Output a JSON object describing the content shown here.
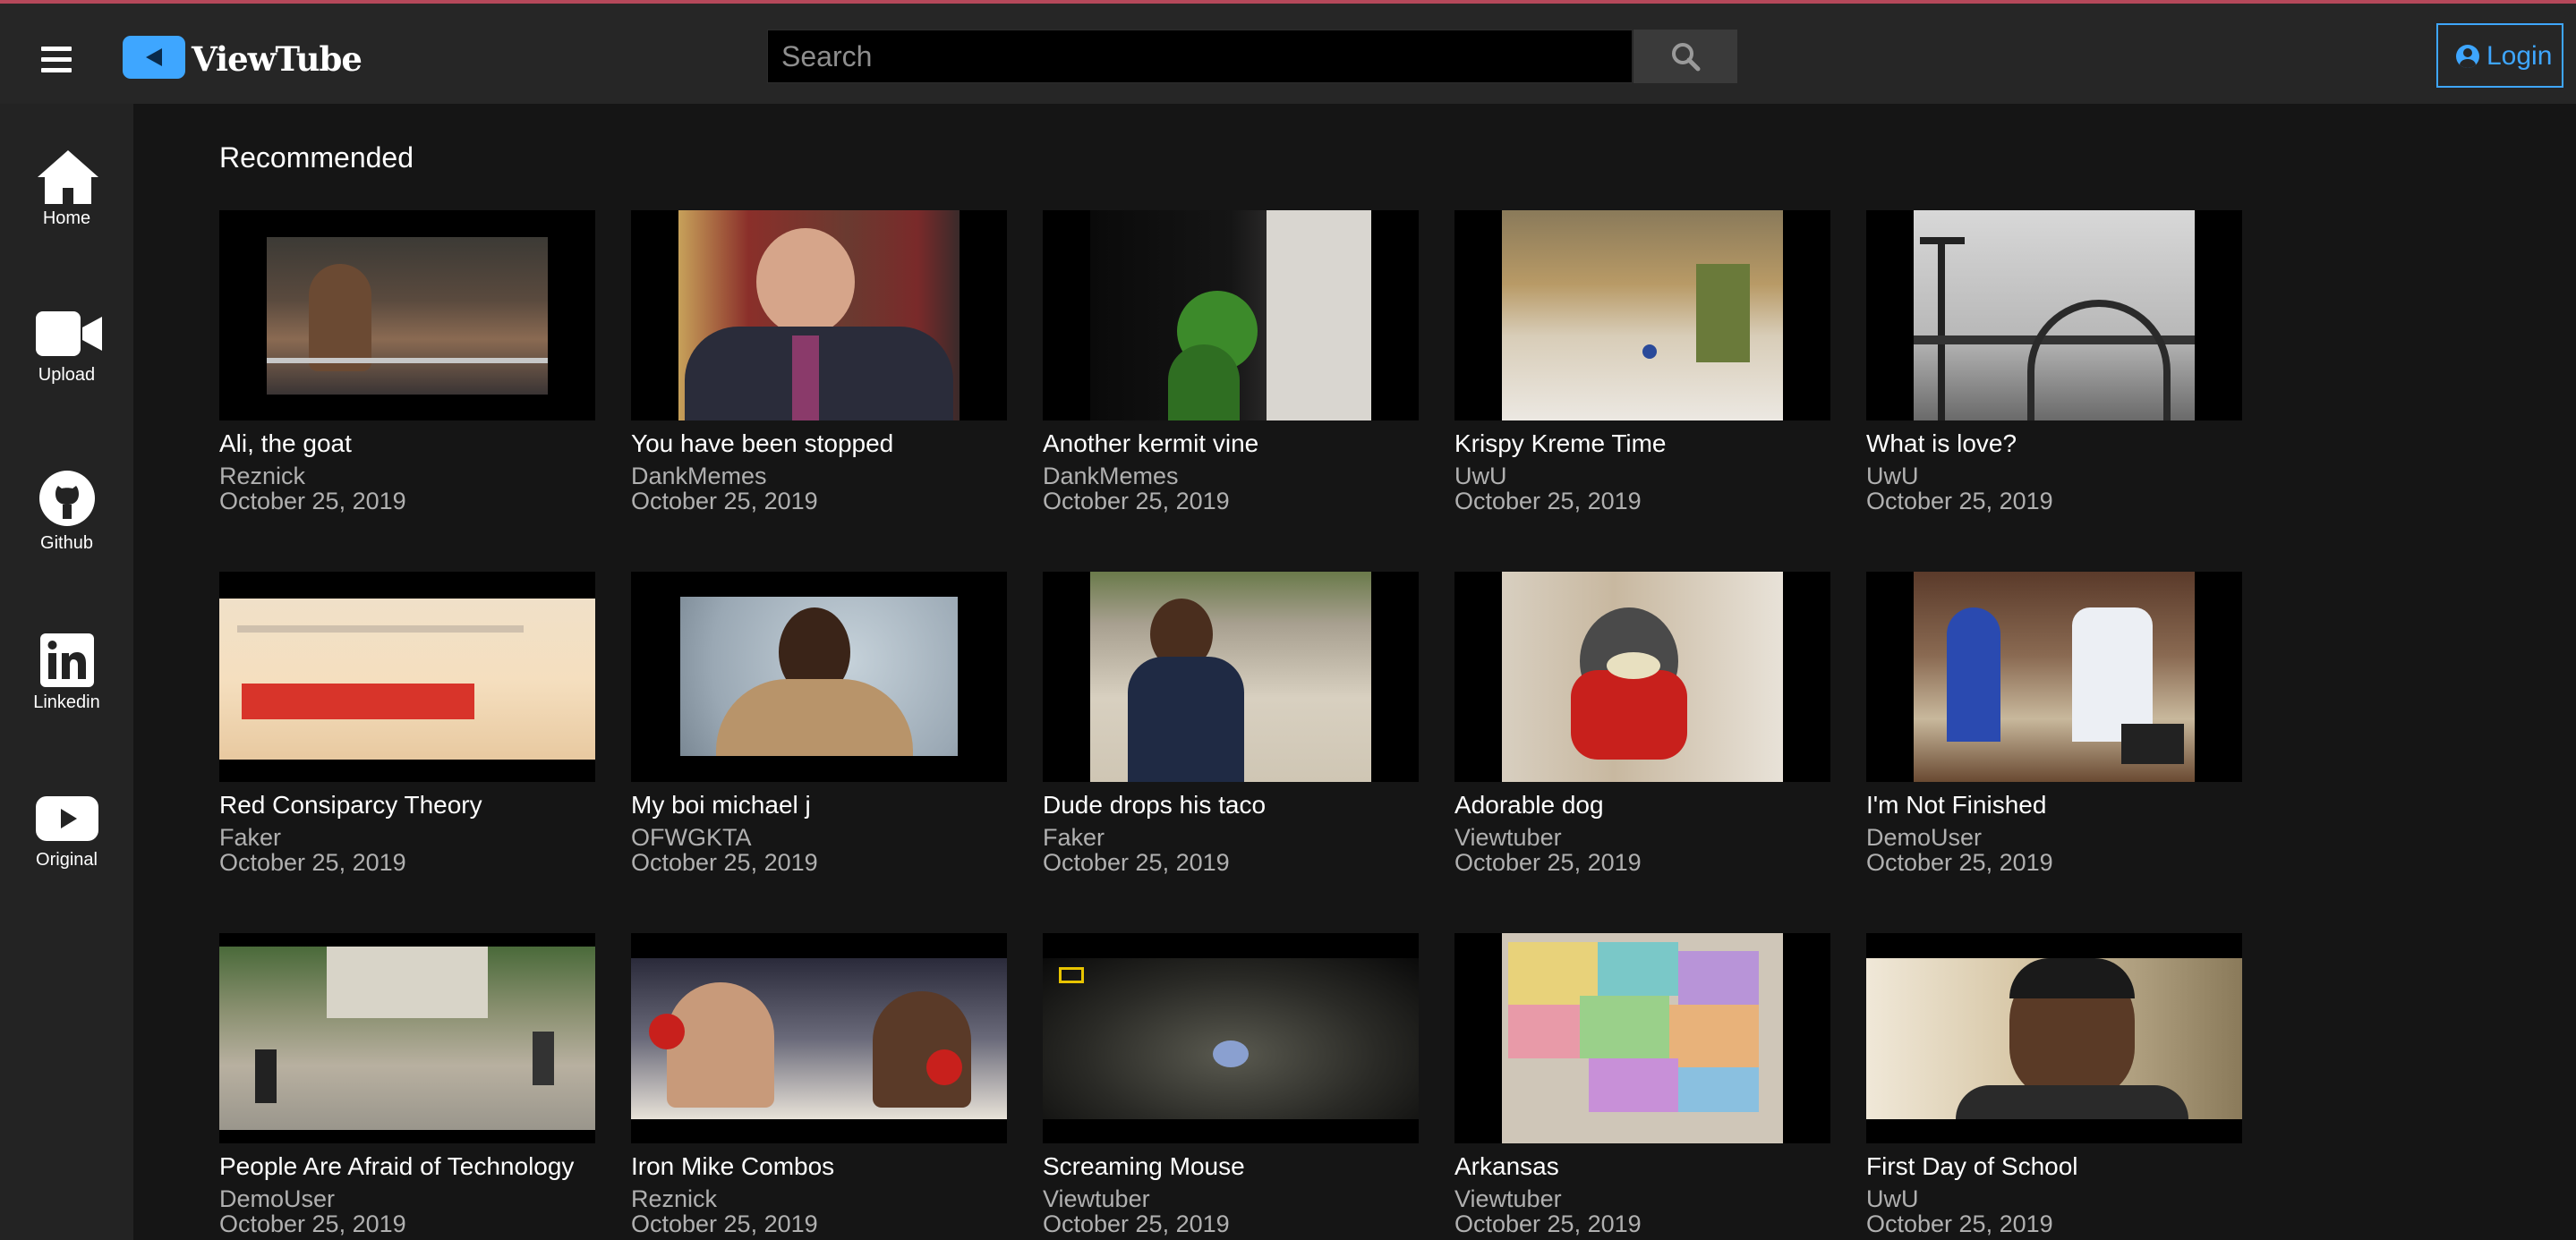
{
  "header": {
    "logo_text": "ViewTube",
    "search_placeholder": "Search",
    "login_label": "Login"
  },
  "sidebar": {
    "items": [
      {
        "label": "Home",
        "icon": "home-icon"
      },
      {
        "label": "Upload",
        "icon": "video-camera-icon"
      },
      {
        "label": "Github",
        "icon": "github-icon"
      },
      {
        "label": "Linkedin",
        "icon": "linkedin-icon"
      },
      {
        "label": "Original",
        "icon": "youtube-icon"
      }
    ]
  },
  "main": {
    "section_title": "Recommended",
    "videos": [
      {
        "title": "Ali, the goat",
        "channel": "Reznick",
        "date": "October 25, 2019"
      },
      {
        "title": "You have been stopped",
        "channel": "DankMemes",
        "date": "October 25, 2019"
      },
      {
        "title": "Another kermit vine",
        "channel": "DankMemes",
        "date": "October 25, 2019"
      },
      {
        "title": "Krispy Kreme Time",
        "channel": "UwU",
        "date": "October 25, 2019"
      },
      {
        "title": "What is love?",
        "channel": "UwU",
        "date": "October 25, 2019"
      },
      {
        "title": "Red Consiparcy Theory",
        "channel": "Faker",
        "date": "October 25, 2019"
      },
      {
        "title": "My boi michael j",
        "channel": "OFWGKTA",
        "date": "October 25, 2019"
      },
      {
        "title": "Dude drops his taco",
        "channel": "Faker",
        "date": "October 25, 2019"
      },
      {
        "title": "Adorable dog",
        "channel": "Viewtuber",
        "date": "October 25, 2019"
      },
      {
        "title": "I'm Not Finished",
        "channel": "DemoUser",
        "date": "October 25, 2019"
      },
      {
        "title": "People Are Afraid of Technology",
        "channel": "DemoUser",
        "date": "October 25, 2019"
      },
      {
        "title": "Iron Mike Combos",
        "channel": "Reznick",
        "date": "October 25, 2019"
      },
      {
        "title": "Screaming Mouse",
        "channel": "Viewtuber",
        "date": "October 25, 2019"
      },
      {
        "title": "Arkansas",
        "channel": "Viewtuber",
        "date": "October 25, 2019"
      },
      {
        "title": "First Day of School",
        "channel": "UwU",
        "date": "October 25, 2019"
      }
    ]
  },
  "colors": {
    "accent": "#3ea6ff",
    "header_bg": "#262626",
    "sidebar_bg": "#232323",
    "page_bg": "#151515"
  }
}
